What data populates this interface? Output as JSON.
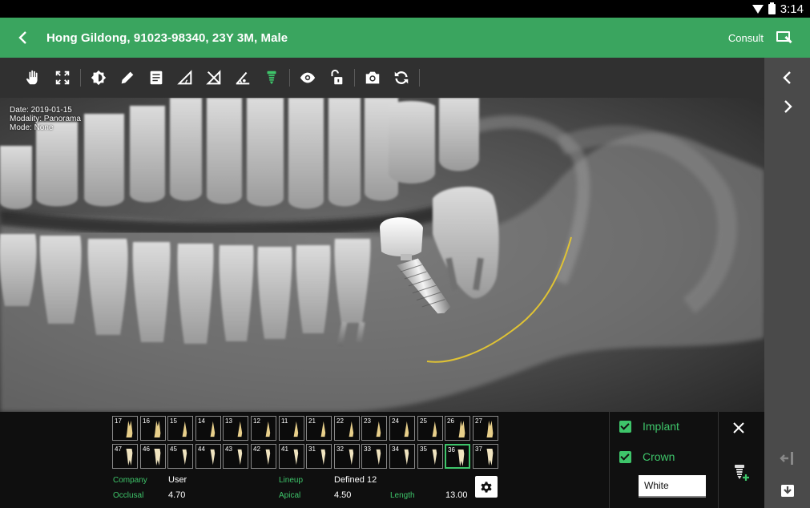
{
  "status_bar": {
    "time": "3:14"
  },
  "header": {
    "patient": "Hong Gildong, 91023-98340, 23Y 3M, Male",
    "consult_label": "Consult"
  },
  "toolbar": {
    "tools": [
      "hand-icon",
      "fit-screen-icon",
      "brightness-icon",
      "pencil-icon",
      "notes-icon",
      "angle-icon",
      "cobb-angle-icon",
      "protractor-icon",
      "implant-tool-icon",
      "eye-icon",
      "unlock-icon",
      "camera-icon",
      "refresh-icon"
    ]
  },
  "image_meta": {
    "date": "Date: 2019-01-15",
    "modality": "Modality: Panorama",
    "mode": "Mode: None"
  },
  "teeth": {
    "upper": [
      "17",
      "16",
      "15",
      "14",
      "13",
      "12",
      "11",
      "21",
      "22",
      "23",
      "24",
      "25",
      "26",
      "27"
    ],
    "lower": [
      "47",
      "46",
      "45",
      "44",
      "43",
      "42",
      "41",
      "31",
      "32",
      "33",
      "34",
      "35",
      "36",
      "37"
    ],
    "selected": "36"
  },
  "implant_info": {
    "company_label": "Company",
    "company_value": "User",
    "lineup_label": "Lineup",
    "lineup_value": "Defined 12",
    "occlusal_label": "Occlusal",
    "occlusal_value": "4.70",
    "apical_label": "Apical",
    "apical_value": "4.50",
    "length_label": "Length",
    "length_value": "13.00"
  },
  "options": {
    "implant_label": "Implant",
    "implant_checked": true,
    "crown_label": "Crown",
    "crown_checked": true,
    "crown_color": "White"
  },
  "colors": {
    "accent": "#3aa55f",
    "nerve_line": "#e0c334",
    "active_tool": "#3ec56a"
  }
}
